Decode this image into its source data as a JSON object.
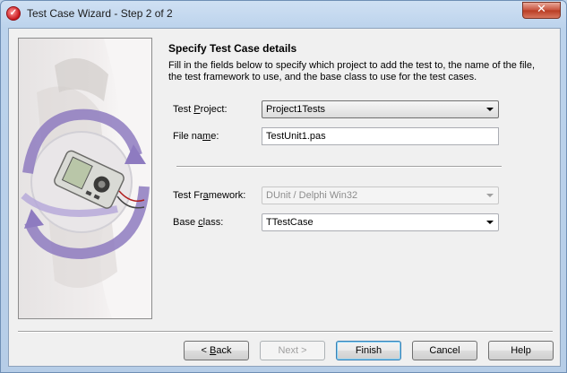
{
  "window": {
    "title": "Test Case Wizard - Step 2 of 2",
    "close_label": "✕"
  },
  "page": {
    "heading": "Specify Test Case details",
    "description": "Fill in the fields below to specify which project to add the test to, the name of the file, the test framework to use, and the base class to use for the test cases."
  },
  "form": {
    "test_project": {
      "label_pre": "Test ",
      "label_key": "P",
      "label_post": "roject:",
      "value": "Project1Tests"
    },
    "file_name": {
      "label_pre": "File na",
      "label_key": "m",
      "label_post": "e:",
      "value": "TestUnit1.pas"
    },
    "test_framework": {
      "label_pre": "Test Fr",
      "label_key": "a",
      "label_post": "mework:",
      "value": "DUnit / Delphi Win32"
    },
    "base_class": {
      "label_pre": "Base ",
      "label_key": "c",
      "label_post": "lass:",
      "value": "TTestCase"
    }
  },
  "buttons": {
    "back": {
      "key": "B",
      "pre": "< ",
      "post": "ack"
    },
    "next": "Next >",
    "finish": "Finish",
    "cancel": "Cancel",
    "help": "Help"
  },
  "colors": {
    "accent": "#3c7fb1",
    "disabled_text": "#8d8d8d"
  }
}
